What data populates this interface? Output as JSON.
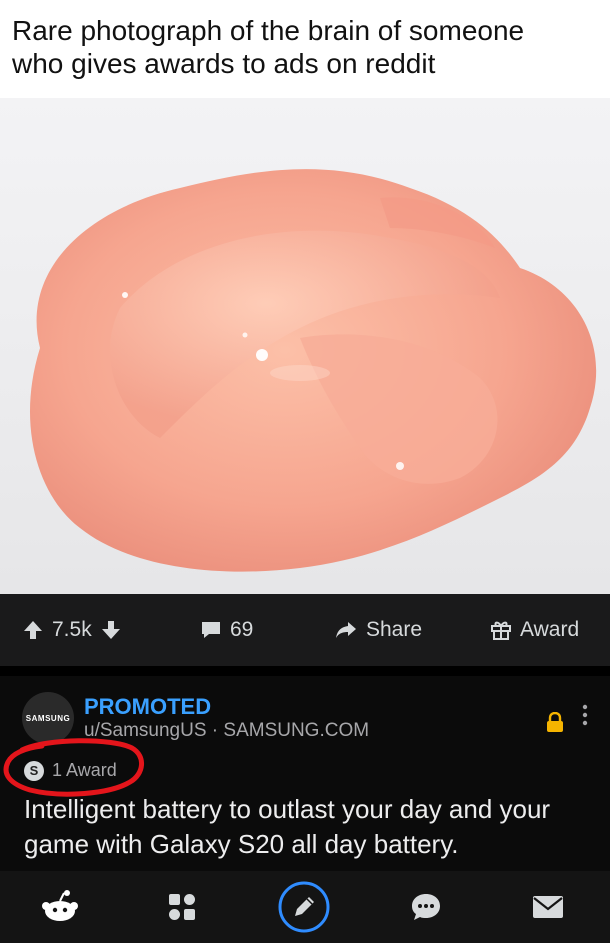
{
  "meme": {
    "caption_line1": "Rare photograph of the brain of someone",
    "caption_line2": "who gives awards to ads on reddit"
  },
  "action_bar": {
    "score": "7.5k",
    "comments": "69",
    "share_label": "Share",
    "award_label": "Award"
  },
  "promoted_post": {
    "avatar_text": "SAMSUNG",
    "promoted_label": "PROMOTED",
    "byline": "u/SamsungUS · SAMSUNG.COM",
    "award_badge_letter": "S",
    "awards_text": "1 Award",
    "title": "Intelligent battery to outlast your day and your game with Galaxy S20 all day battery."
  },
  "colors": {
    "promoted_blue": "#3aa0ff",
    "annotation_red": "#e4151b",
    "lock_yellow": "#f5b400",
    "compose_blue": "#2f8cff"
  },
  "icons": {
    "upvote": "arrow-up-icon",
    "downvote": "arrow-down-icon",
    "comments": "comment-bubble-icon",
    "share": "share-arrow-icon",
    "award": "gift-icon",
    "lock": "lock-icon",
    "more": "kebab-icon",
    "nav": [
      "snoo-home-icon",
      "communities-grid-icon",
      "compose-pencil-icon",
      "chat-bubble-icon",
      "inbox-mail-icon"
    ]
  }
}
